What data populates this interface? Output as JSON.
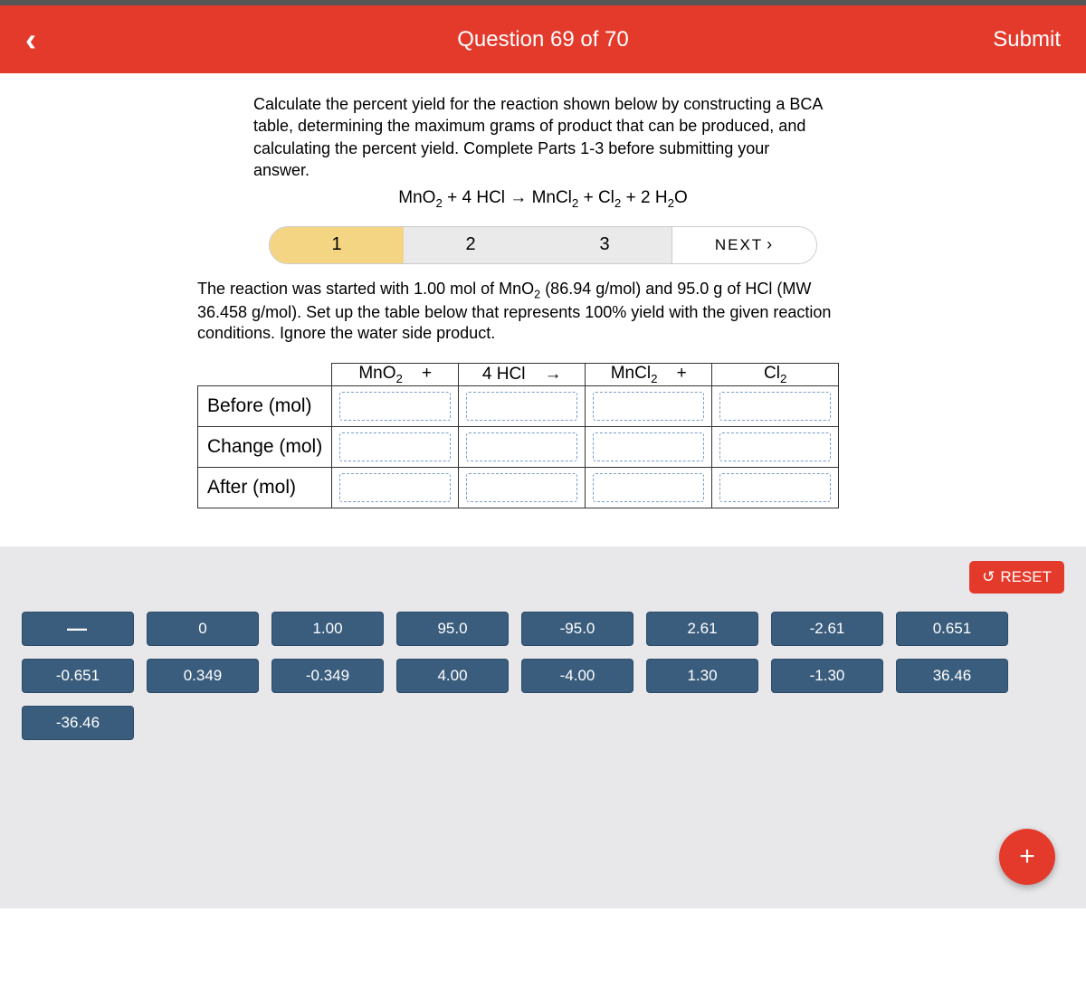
{
  "header": {
    "title": "Question 69 of 70",
    "submit": "Submit"
  },
  "question": {
    "text": "Calculate the percent yield for the reaction shown below by constructing a BCA table, determining the maximum grams of product that can be produced, and calculating the percent yield. Complete Parts 1-3 before submitting your answer.",
    "eq_1": "MnO",
    "eq_2": " + 4 HCl → MnCl",
    "eq_3": " + Cl",
    "eq_4": " + 2 H",
    "eq_5": "O",
    "eq_s1": "2",
    "eq_s2": "2",
    "eq_s3": "2",
    "eq_s4": "2"
  },
  "steps": {
    "s1": "1",
    "s2": "2",
    "s3": "3",
    "next": "NEXT"
  },
  "subtext": {
    "a": "The reaction was started with 1.00 mol of MnO",
    "b": " (86.94 g/mol) and 95.0 g of HCl (MW 36.458 g/mol). Set up the table below that represents 100% yield with the given reaction conditions. Ignore the water side product.",
    "sub": "2"
  },
  "table": {
    "c1a": "MnO",
    "c1s": "2",
    "plus1": "+",
    "c2": "4 HCl",
    "arrow": "→",
    "c3a": "MnCl",
    "c3s": "2",
    "plus2": "+",
    "c4a": "Cl",
    "c4s": "2",
    "r1": "Before (mol)",
    "r2": "Change (mol)",
    "r3": "After (mol)"
  },
  "reset": "RESET",
  "tiles": [
    "—",
    "0",
    "1.00",
    "95.0",
    "-95.0",
    "2.61",
    "-2.61",
    "0.651",
    "-0.651",
    "0.349",
    "-0.349",
    "4.00",
    "-4.00",
    "1.30",
    "-1.30",
    "36.46",
    "-36.46"
  ],
  "fab": "+"
}
